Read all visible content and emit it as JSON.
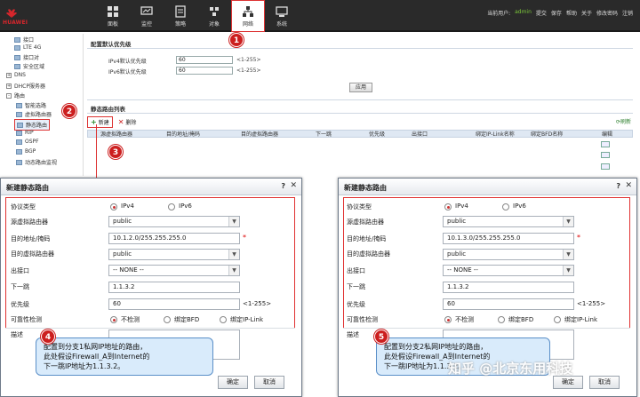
{
  "header": {
    "logo_text": "HUAWEI",
    "nav": [
      {
        "label": "面板",
        "icon": "dashboard-icon"
      },
      {
        "label": "监控",
        "icon": "monitor-icon"
      },
      {
        "label": "策略",
        "icon": "policy-icon"
      },
      {
        "label": "对象",
        "icon": "object-icon"
      },
      {
        "label": "网络",
        "icon": "network-icon",
        "active": true
      },
      {
        "label": "系统",
        "icon": "system-icon"
      }
    ],
    "user_prefix": "当前用户:",
    "user": "admin",
    "links": [
      "提交",
      "保存",
      "帮助",
      "关于",
      "修改密码",
      "注销"
    ]
  },
  "sidebar": {
    "items": [
      {
        "label": "接口",
        "indent": 1
      },
      {
        "label": "LTE 4G",
        "indent": 1
      },
      {
        "label": "接口对",
        "indent": 1
      },
      {
        "label": "安全区域",
        "indent": 1
      },
      {
        "label": "DNS",
        "indent": 0
      },
      {
        "label": "DHCP服务器",
        "indent": 0
      },
      {
        "label": "路由",
        "indent": 0
      },
      {
        "label": "智能选路",
        "indent": 1
      },
      {
        "label": "虚拟路由器",
        "indent": 1
      },
      {
        "label": "静态路由",
        "indent": 1,
        "selected": true
      },
      {
        "label": "RIP",
        "indent": 1
      },
      {
        "label": "OSPF",
        "indent": 1
      },
      {
        "label": "BGP",
        "indent": 1
      },
      {
        "label": "动态路由监视",
        "indent": 1
      }
    ]
  },
  "priority_panel": {
    "title": "配置默认优先级",
    "ipv4_label": "IPv4默认优先级",
    "ipv4_value": "60",
    "ipv4_range": "<1-255>",
    "ipv6_label": "IPv6默认优先级",
    "ipv6_value": "60",
    "ipv6_range": "<1-255>",
    "apply": "应用"
  },
  "route_list": {
    "title": "静态路由列表",
    "new_label": "新建",
    "delete_label": "删除",
    "refresh_label": "刷新",
    "columns": [
      "源虚拟路由器",
      "目的地址/掩码",
      "目的虚拟路由器",
      "下一跳",
      "优先级",
      "出接口",
      "绑定IP-Link名称",
      "绑定BFD名称",
      "编辑"
    ]
  },
  "badges": [
    "1",
    "2",
    "3",
    "4",
    "5"
  ],
  "dialogs": [
    {
      "title": "新建静态路由",
      "help": "?",
      "close": "✕",
      "protocol_label": "协议类型",
      "ipv4": "IPv4",
      "ipv6": "IPv6",
      "src_vr_label": "源虚拟路由器",
      "src_vr": "public",
      "dest_label": "目的地址/掩码",
      "dest": "10.1.2.0/255.255.255.0",
      "dest_vr_label": "目的虚拟路由器",
      "dest_vr": "public",
      "out_if_label": "出接口",
      "out_if": "-- NONE --",
      "nexthop_label": "下一跳",
      "nexthop": "1.1.3.2",
      "priority_label": "优先级",
      "priority": "60",
      "priority_range": "<1-255>",
      "reach_label": "可靠性检测",
      "reach_none": "不检测",
      "reach_bfd": "绑定BFD",
      "reach_iplink": "绑定IP-Link",
      "desc_label": "描述",
      "ok": "确定",
      "cancel": "取消",
      "tip": [
        "配置到分支1私网IP地址的路由，",
        "此处假设Firewall_A到Internet的",
        "下一跳IP地址为1.1.3.2。"
      ]
    },
    {
      "title": "新建静态路由",
      "help": "?",
      "close": "✕",
      "protocol_label": "协议类型",
      "ipv4": "IPv4",
      "ipv6": "IPv6",
      "src_vr_label": "源虚拟路由器",
      "src_vr": "public",
      "dest_label": "目的地址/掩码",
      "dest": "10.1.3.0/255.255.255.0",
      "dest_vr_label": "目的虚拟路由器",
      "dest_vr": "public",
      "out_if_label": "出接口",
      "out_if": "-- NONE --",
      "nexthop_label": "下一跳",
      "nexthop": "1.1.3.2",
      "priority_label": "优先级",
      "priority": "60",
      "priority_range": "<1-255>",
      "reach_label": "可靠性检测",
      "reach_none": "不检测",
      "reach_bfd": "绑定BFD",
      "reach_iplink": "绑定IP-Link",
      "desc_label": "描述",
      "ok": "确定",
      "cancel": "取消",
      "tip": [
        "配置到分支2私网IP地址的路由，",
        "此处假设Firewall_A到Internet的",
        "下一跳IP地址为1.1.3.2。"
      ]
    }
  ],
  "watermark": "知乎 @北京东用科技",
  "colors": {
    "accent_red": "#cc1f1f",
    "header_bg": "#2a2a2a",
    "tip_bg": "#d9ebfb",
    "user_green": "#7cc93a"
  }
}
